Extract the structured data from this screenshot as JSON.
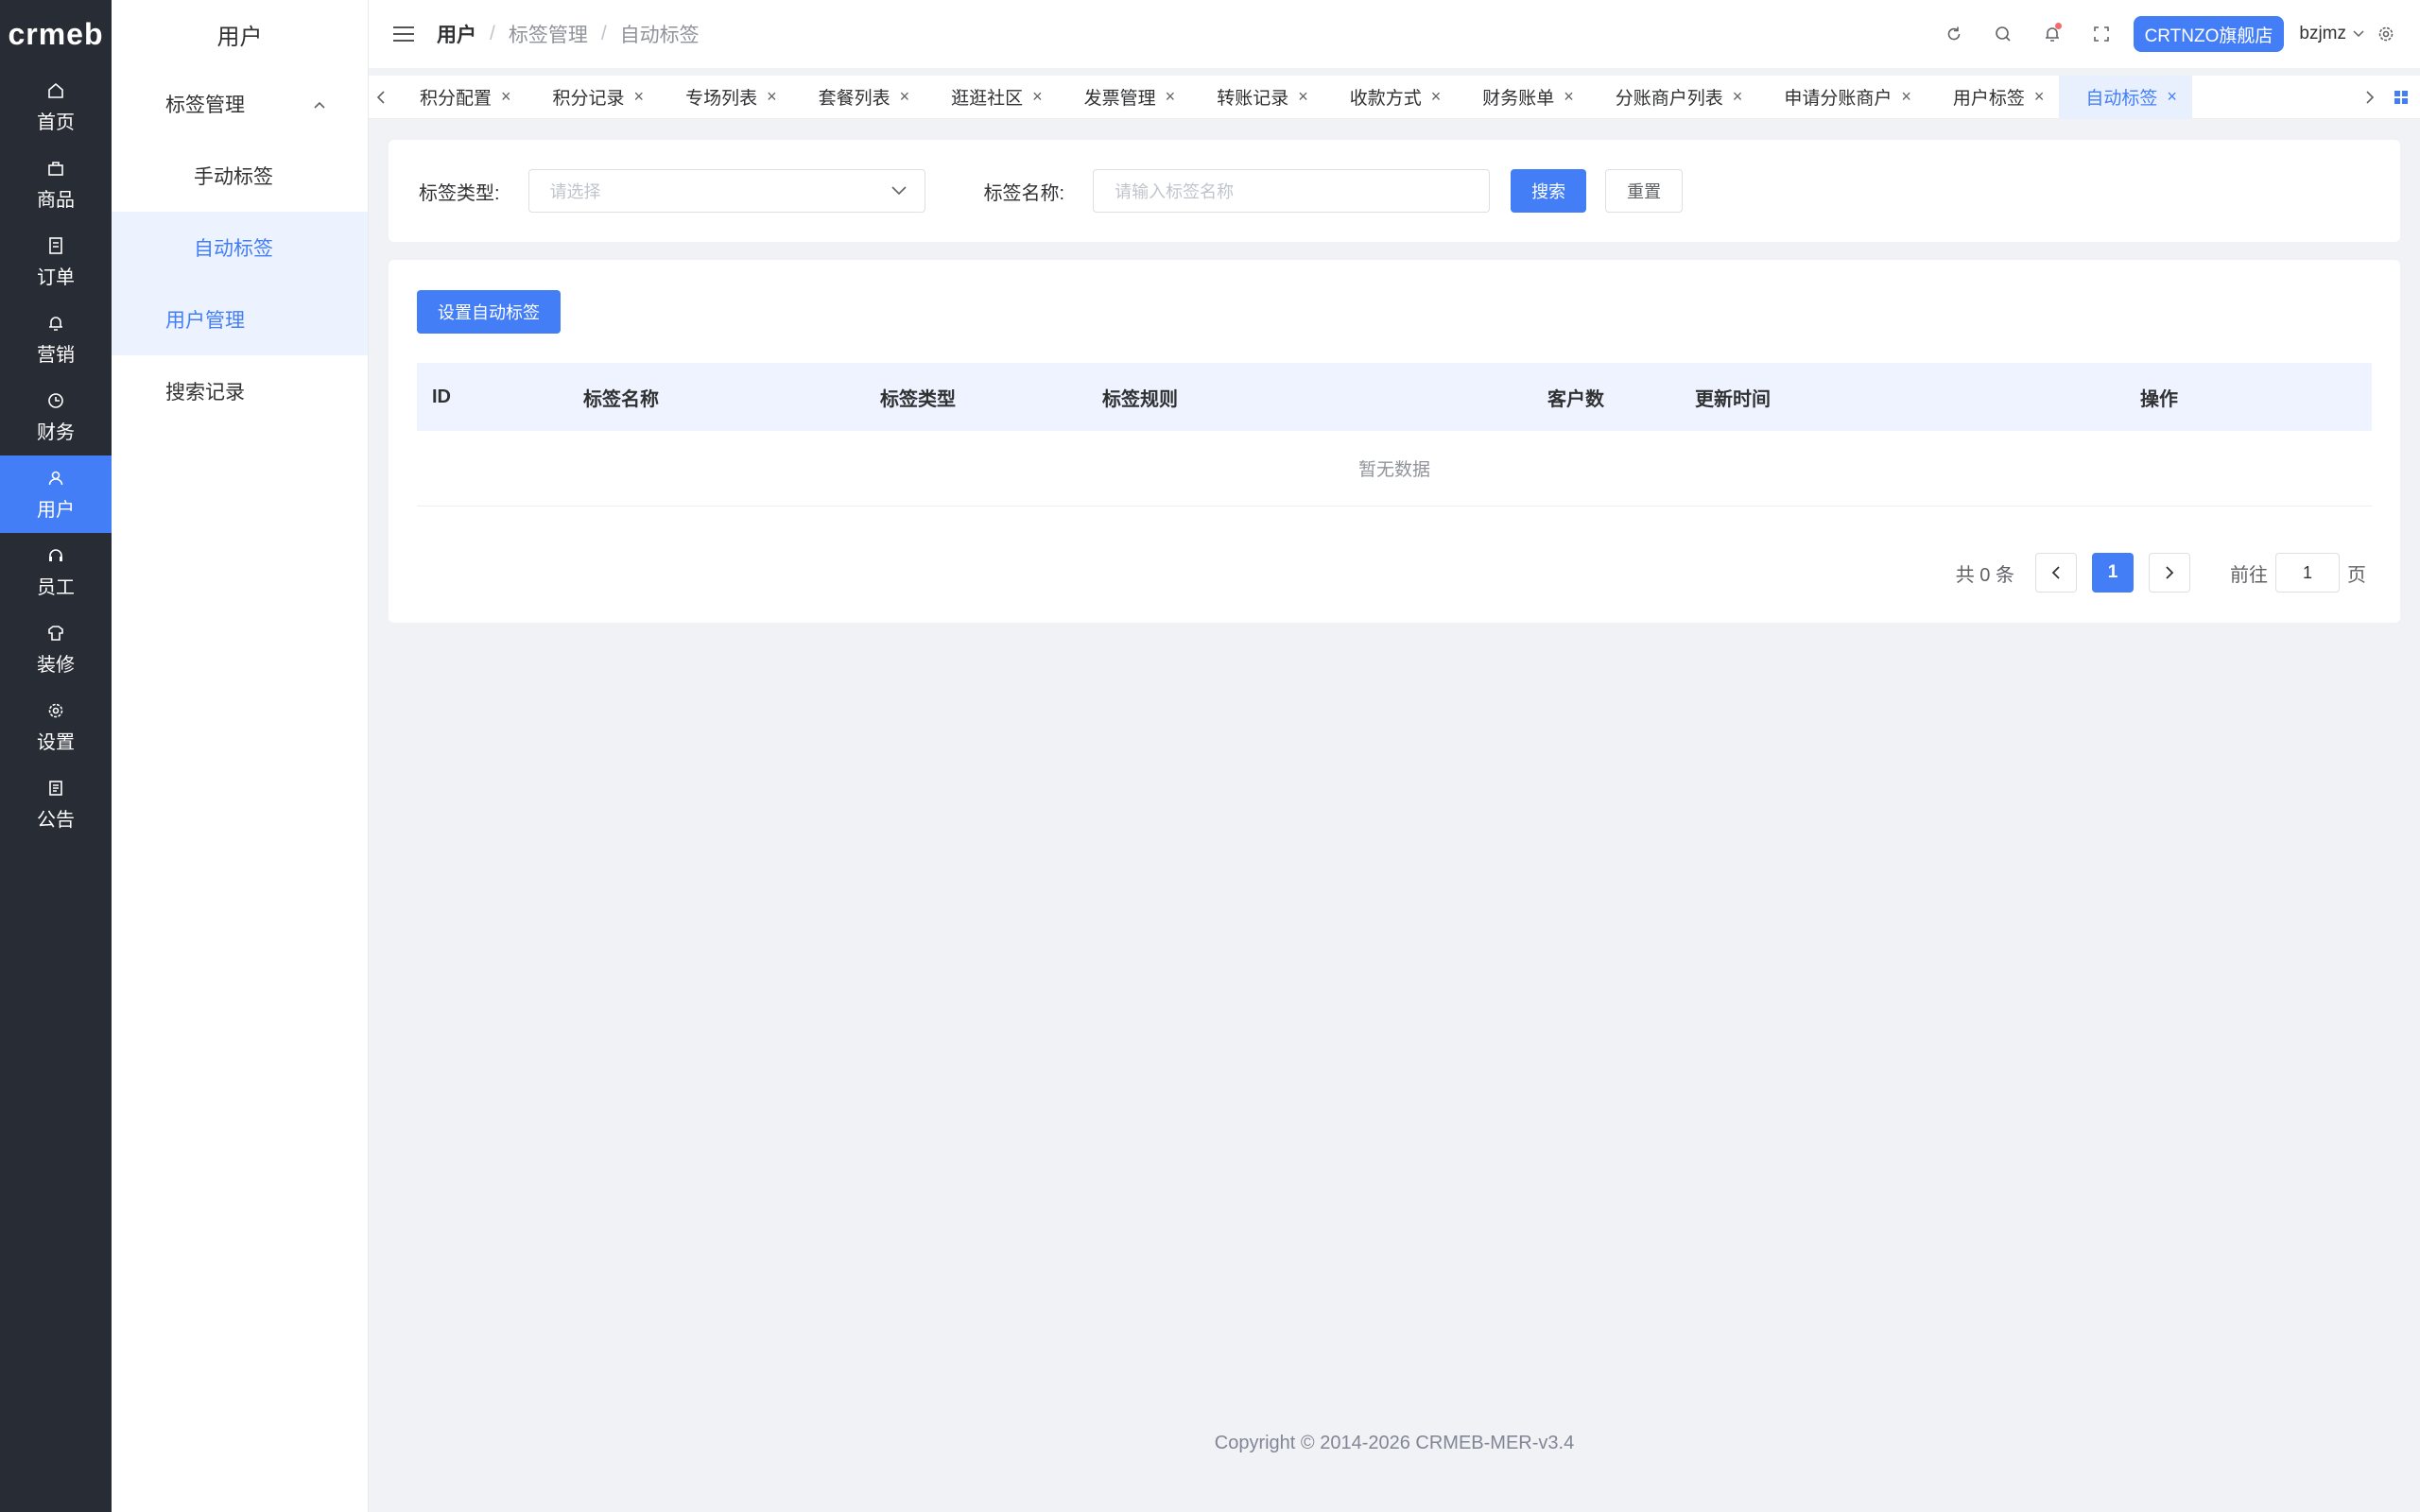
{
  "brand": "crmeb",
  "rail": [
    {
      "label": "首页",
      "icon": "home-icon"
    },
    {
      "label": "商品",
      "icon": "bag-icon"
    },
    {
      "label": "订单",
      "icon": "document-icon"
    },
    {
      "label": "营销",
      "icon": "bell-icon"
    },
    {
      "label": "财务",
      "icon": "clock-icon"
    },
    {
      "label": "用户",
      "icon": "user-icon",
      "active": true
    },
    {
      "label": "员工",
      "icon": "headset-icon"
    },
    {
      "label": "装修",
      "icon": "shirt-icon"
    },
    {
      "label": "设置",
      "icon": "gear-icon"
    },
    {
      "label": "公告",
      "icon": "notice-icon"
    }
  ],
  "submenu": {
    "title": "用户",
    "group": "标签管理",
    "items": [
      "手动标签",
      "自动标签"
    ],
    "others": [
      "用户管理",
      "搜索记录"
    ]
  },
  "header": {
    "breadcrumb": [
      "用户",
      "标签管理",
      "自动标签"
    ],
    "store": "CRTNZO旗舰店",
    "user": "bzjmz"
  },
  "tags": [
    "积分配置",
    "积分记录",
    "专场列表",
    "套餐列表",
    "逛逛社区",
    "发票管理",
    "转账记录",
    "收款方式",
    "财务账单",
    "分账商户列表",
    "申请分账商户",
    "用户标签",
    "自动标签"
  ],
  "search": {
    "type_label": "标签类型:",
    "type_placeholder": "请选择",
    "name_label": "标签名称:",
    "name_placeholder": "请输入标签名称",
    "search_btn": "搜索",
    "reset_btn": "重置"
  },
  "table": {
    "add_btn": "设置自动标签",
    "columns": [
      "ID",
      "标签名称",
      "标签类型",
      "标签规则",
      "客户数",
      "更新时间",
      "操作"
    ],
    "empty": "暂无数据"
  },
  "pagination": {
    "total": "共 0 条",
    "current": "1",
    "goto_label": "前往",
    "goto_value": "1",
    "page_suffix": "页"
  },
  "footer": "Copyright © 2014-2026 CRMEB-MER-v3.4",
  "colors": {
    "primary": "#437ef7",
    "rail_bg": "#282c34",
    "page_bg": "#f0f2f5"
  }
}
